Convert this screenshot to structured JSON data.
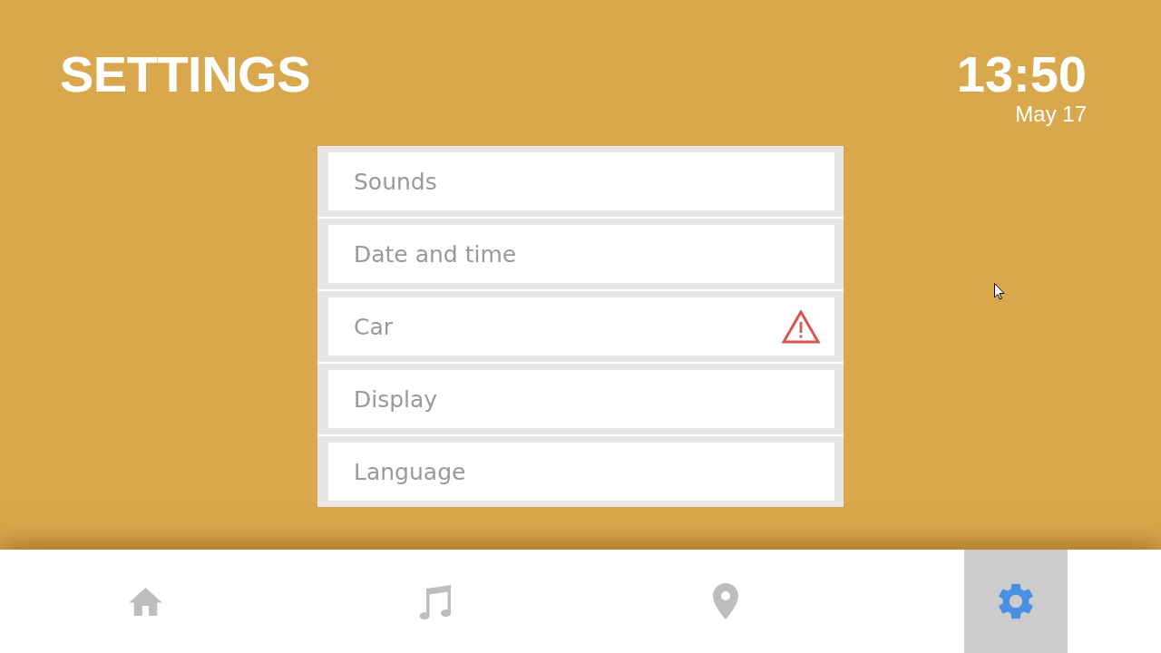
{
  "header": {
    "title": "SETTINGS",
    "time": "13:50",
    "date": "May 17"
  },
  "menu": {
    "items": [
      {
        "label": "Sounds",
        "warning": false
      },
      {
        "label": "Date and time",
        "warning": false
      },
      {
        "label": "Car",
        "warning": true
      },
      {
        "label": "Display",
        "warning": false
      },
      {
        "label": "Language",
        "warning": false
      }
    ]
  },
  "nav": {
    "tabs": [
      {
        "kind": "home",
        "selected": false
      },
      {
        "kind": "music",
        "selected": false
      },
      {
        "kind": "location",
        "selected": false
      },
      {
        "kind": "settings",
        "selected": true
      }
    ]
  }
}
